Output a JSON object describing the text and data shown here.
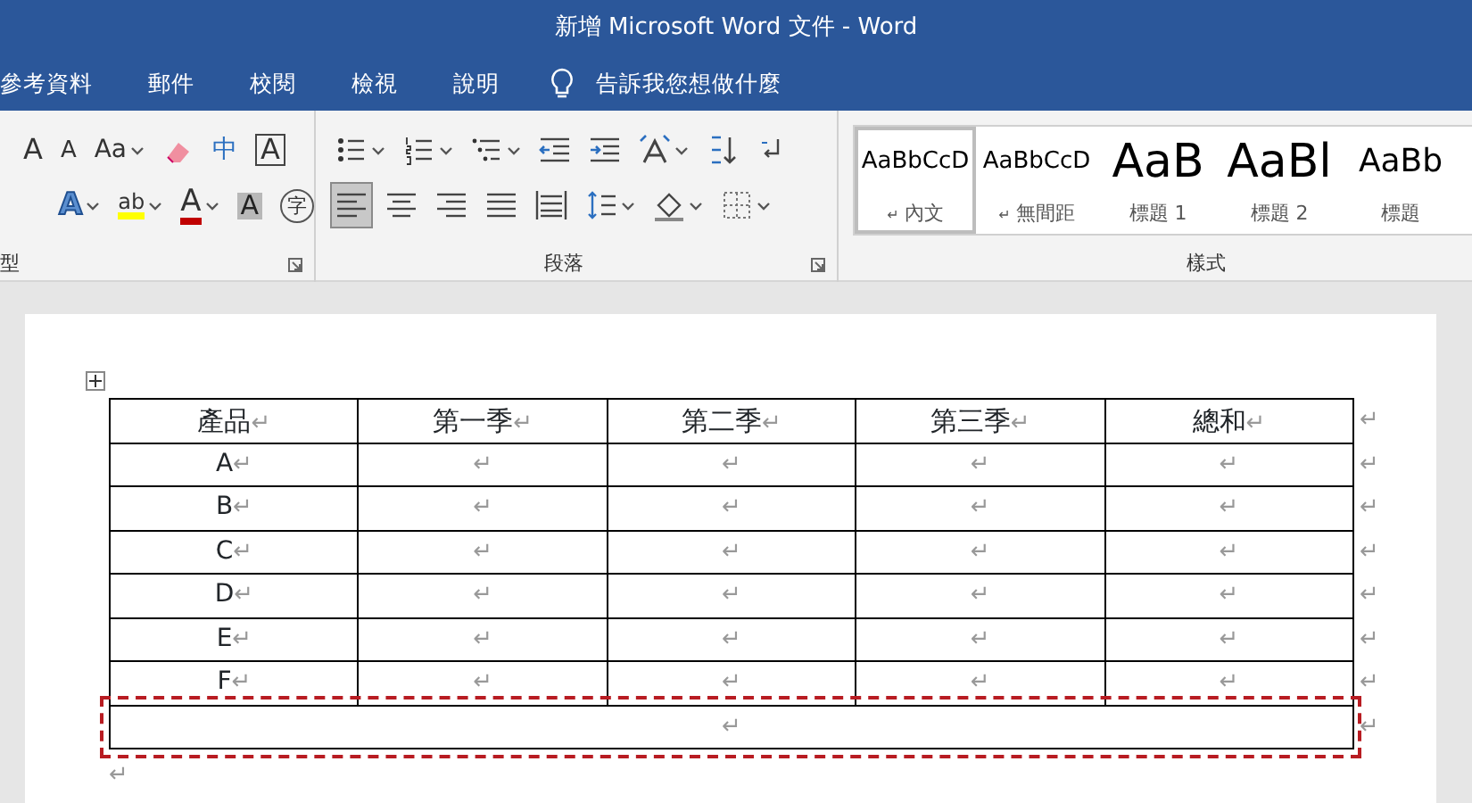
{
  "window": {
    "title": "新增 Microsoft Word 文件  -  Word"
  },
  "menu_tabs": [
    {
      "label": "參考資料"
    },
    {
      "label": "郵件"
    },
    {
      "label": "校閱"
    },
    {
      "label": "檢視"
    },
    {
      "label": "說明"
    }
  ],
  "tell_me": {
    "label": "告訴我您想做什麼"
  },
  "font_group": {
    "label": "型",
    "tool_rows": [
      {
        "tools": [
          {
            "kind": "grow",
            "glyph": "A"
          },
          {
            "kind": "shrink",
            "glyph": "A"
          },
          {
            "kind": "case",
            "glyph": "Aa",
            "dropdown": true
          },
          {
            "kind": "clear"
          },
          {
            "kind": "phonetic",
            "glyph": "中"
          },
          {
            "kind": "border",
            "glyph": "A"
          }
        ]
      },
      {
        "tools": [
          {
            "kind": "effects",
            "glyph": "A",
            "dropdown": true
          },
          {
            "kind": "highlight",
            "glyph": "ab",
            "dropdown": true
          },
          {
            "kind": "color",
            "glyph": "A",
            "dropdown": true
          },
          {
            "kind": "shading",
            "glyph": "A"
          },
          {
            "kind": "enclosed",
            "glyph": "字"
          }
        ]
      }
    ]
  },
  "paragraph_group": {
    "label": "段落",
    "tool_rows": [
      {
        "tools": [
          {
            "kind": "bullets",
            "dropdown": true,
            "selected": false
          },
          {
            "kind": "numbering",
            "dropdown": true,
            "selected": false
          },
          {
            "kind": "multilevel",
            "dropdown": true,
            "selected": false
          },
          {
            "kind": "outdent",
            "selected": false
          },
          {
            "kind": "indent",
            "selected": false
          },
          {
            "kind": "direction",
            "dropdown": true,
            "selected": false
          },
          {
            "kind": "sort",
            "selected": false
          },
          {
            "kind": "marks",
            "selected": false
          }
        ]
      },
      {
        "tools": [
          {
            "kind": "align-left",
            "selected": true
          },
          {
            "kind": "center",
            "selected": false
          },
          {
            "kind": "align-right",
            "selected": false
          },
          {
            "kind": "justify",
            "selected": false
          },
          {
            "kind": "distribute",
            "selected": false
          },
          {
            "kind": "line-spacing",
            "dropdown": true,
            "selected": false
          },
          {
            "kind": "fill",
            "dropdown": true,
            "selected": false
          },
          {
            "kind": "borders",
            "dropdown": true,
            "selected": false
          }
        ]
      }
    ]
  },
  "styles_group": {
    "label": "樣式",
    "styles": [
      {
        "preview": "AaBbCcD",
        "name": "內文",
        "para_mark": "↵",
        "kind": "normal",
        "selected": true
      },
      {
        "preview": "AaBbCcD",
        "name": "無間距",
        "para_mark": "↵",
        "kind": "no-spacing",
        "selected": false
      },
      {
        "preview": "AaB",
        "name": "標題 1",
        "kind": "heading-1",
        "selected": false
      },
      {
        "preview": "AaBl",
        "name": "標題 2",
        "kind": "heading-2",
        "selected": false
      },
      {
        "preview": "AaBb",
        "name": "標題",
        "kind": "title",
        "selected": false
      }
    ]
  },
  "table": {
    "rows": [
      {
        "kind": "header",
        "cells": [
          {
            "text": "產品",
            "mark": "↵"
          },
          {
            "text": "第一季",
            "mark": "↵"
          },
          {
            "text": "第二季",
            "mark": "↵"
          },
          {
            "text": "第三季",
            "mark": "↵"
          },
          {
            "text": "總和",
            "mark": "↵"
          }
        ],
        "end_mark": "↵",
        "highlighted": false
      },
      {
        "kind": "body",
        "cells": [
          {
            "text": "A",
            "mark": "↵"
          },
          {
            "mark": "↵"
          },
          {
            "mark": "↵"
          },
          {
            "mark": "↵"
          },
          {
            "mark": "↵"
          }
        ],
        "end_mark": "↵",
        "highlighted": false
      },
      {
        "kind": "body",
        "cells": [
          {
            "text": "B",
            "mark": "↵"
          },
          {
            "mark": "↵"
          },
          {
            "mark": "↵"
          },
          {
            "mark": "↵"
          },
          {
            "mark": "↵"
          }
        ],
        "end_mark": "↵",
        "highlighted": false
      },
      {
        "kind": "body",
        "cells": [
          {
            "text": "C",
            "mark": "↵"
          },
          {
            "mark": "↵"
          },
          {
            "mark": "↵"
          },
          {
            "mark": "↵"
          },
          {
            "mark": "↵"
          }
        ],
        "end_mark": "↵",
        "highlighted": false
      },
      {
        "kind": "body",
        "cells": [
          {
            "text": "D",
            "mark": "↵"
          },
          {
            "mark": "↵"
          },
          {
            "mark": "↵"
          },
          {
            "mark": "↵"
          },
          {
            "mark": "↵"
          }
        ],
        "end_mark": "↵",
        "highlighted": false
      },
      {
        "kind": "body",
        "cells": [
          {
            "text": "E",
            "mark": "↵"
          },
          {
            "mark": "↵"
          },
          {
            "mark": "↵"
          },
          {
            "mark": "↵"
          },
          {
            "mark": "↵"
          }
        ],
        "end_mark": "↵",
        "highlighted": false
      },
      {
        "kind": "body",
        "cells": [
          {
            "text": "F",
            "mark": "↵"
          },
          {
            "mark": "↵"
          },
          {
            "mark": "↵"
          },
          {
            "mark": "↵"
          },
          {
            "mark": "↵"
          }
        ],
        "end_mark": "↵",
        "highlighted": false
      },
      {
        "kind": "merged",
        "cells": [
          {
            "mark": "↵",
            "colspan": 5
          }
        ],
        "end_mark": "↵",
        "highlighted": true
      }
    ]
  },
  "after_table_mark": "↵"
}
